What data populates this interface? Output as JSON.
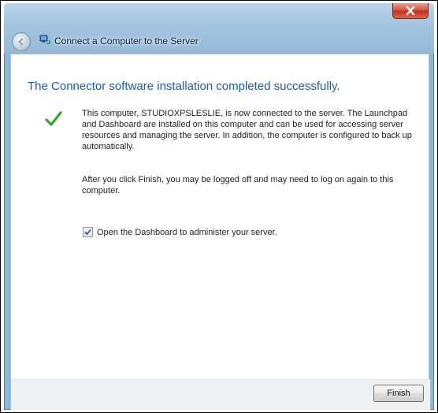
{
  "window": {
    "title": "Connect a Computer to the Server"
  },
  "page": {
    "heading": "The Connector software installation completed successfully.",
    "paragraph1": "This computer, STUDIOXPSLESLIE, is now connected to the server. The Launchpad and Dashboard are installed on this computer and can be used for accessing server resources and managing the server. In addition, the computer is configured to back up automatically.",
    "paragraph2": "After you click Finish, you may be logged off and may need to log on again to this computer.",
    "checkbox": {
      "label": "Open the Dashboard to administer your server.",
      "checked": true
    }
  },
  "footer": {
    "finish_label": "Finish"
  },
  "icons": {
    "close": "close-icon",
    "back": "back-arrow-icon",
    "app": "network-computer-icon",
    "success": "green-checkmark-icon"
  },
  "colors": {
    "heading": "#1e5aa8",
    "checkmark": "#3aa12e",
    "close_button": "#c2331d"
  }
}
